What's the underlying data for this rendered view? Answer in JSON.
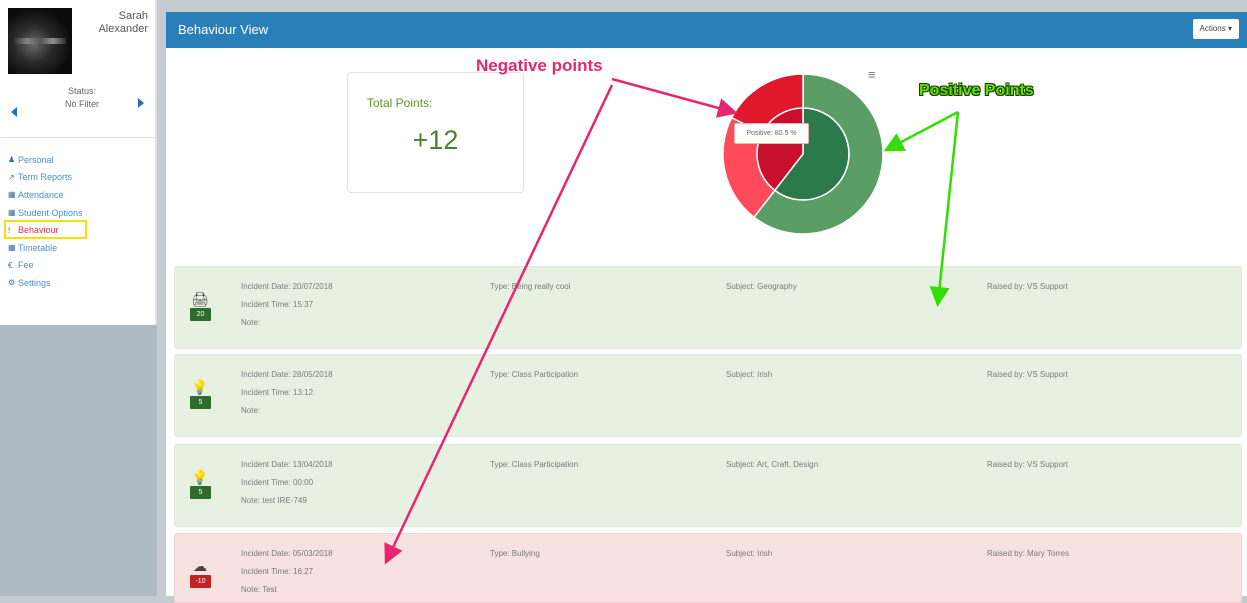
{
  "user": {
    "first_name": "Sarah",
    "last_name": "Alexander"
  },
  "status": {
    "label": "Status:",
    "value": "No Filter"
  },
  "nav": {
    "items": [
      {
        "icon": "person-icon",
        "glyph": "♟",
        "label": "Personal",
        "active": false
      },
      {
        "icon": "chart-icon",
        "glyph": "↗",
        "label": "Term Reports",
        "active": false
      },
      {
        "icon": "calendar-icon",
        "glyph": "▦",
        "label": "Attendance",
        "active": false
      },
      {
        "icon": "calendar-icon",
        "glyph": "▦",
        "label": "Student Options",
        "active": false
      },
      {
        "icon": "exclamation-icon",
        "glyph": "!",
        "label": "Behaviour",
        "active": true
      },
      {
        "icon": "calendar-icon",
        "glyph": "▦",
        "label": "Timetable",
        "active": false
      },
      {
        "icon": "euro-icon",
        "glyph": "€",
        "label": "Fee",
        "active": false
      },
      {
        "icon": "gears-icon",
        "glyph": "⚙",
        "label": "Settings",
        "active": false
      }
    ]
  },
  "header": {
    "title": "Behaviour View",
    "actions_label": "Actions ▾"
  },
  "summary": {
    "total_label": "Total Points:",
    "total_value": "+12"
  },
  "chart_data": {
    "type": "pie",
    "style": "donut",
    "tooltip": "Positive: 80.5 %",
    "inner": [
      {
        "name": "Positive",
        "value": 60.5,
        "color": "#2c7a4a"
      },
      {
        "name": "Negative",
        "value": 39.5,
        "color": "#c8102e"
      }
    ],
    "outer": [
      {
        "name": "Positive",
        "value": 60.5,
        "color": "#5a9e66"
      },
      {
        "name": "Negative",
        "value": 22,
        "color": "#ff4a5c"
      },
      {
        "name": "Negative",
        "value": 17.5,
        "color": "#e0182c"
      }
    ]
  },
  "incidents": [
    {
      "icon": "printer-icon",
      "glyph": "🖨",
      "points": "20",
      "kind": "positive",
      "date": "Incident Date: 20/07/2018",
      "time": "Incident Time: 15:37",
      "note": "Note:",
      "type": "Type: Being really cool",
      "subject": "Subject: Geography",
      "raised": "Raised by: VS Support"
    },
    {
      "icon": "lightbulb-icon",
      "glyph": "💡",
      "points": "5",
      "kind": "positive",
      "date": "Incident Date: 28/05/2018",
      "time": "Incident Time: 13:12",
      "note": "Note:",
      "type": "Type: Class Participation",
      "subject": "Subject: Irish",
      "raised": "Raised by: VS Support"
    },
    {
      "icon": "lightbulb-icon",
      "glyph": "💡",
      "points": "5",
      "kind": "positive",
      "date": "Incident Date: 13/04/2018",
      "time": "Incident Time: 00:00",
      "note": "Note: test IRE-749",
      "type": "Type: Class Participation",
      "subject": "Subject: Art, Craft, Design",
      "raised": "Raised by: VS Support"
    },
    {
      "icon": "storm-cloud-icon",
      "glyph": "☁",
      "points": "-10",
      "kind": "negative",
      "date": "Incident Date: 05/03/2018",
      "time": "Incident Time: 16:27",
      "note": "Note: Test",
      "type": "Type: Bullying",
      "subject": "Subject: Irish",
      "raised": "Raised by: Mary Torres"
    }
  ],
  "annotations": {
    "negative": "Negative points",
    "positive": "Positive Points"
  },
  "colors": {
    "header": "#2b7fb8",
    "positive_row": "#e7f1e1",
    "negative_row": "#f7e1e1",
    "annotation_negative": "#e8256f",
    "annotation_positive": "#62e000"
  }
}
